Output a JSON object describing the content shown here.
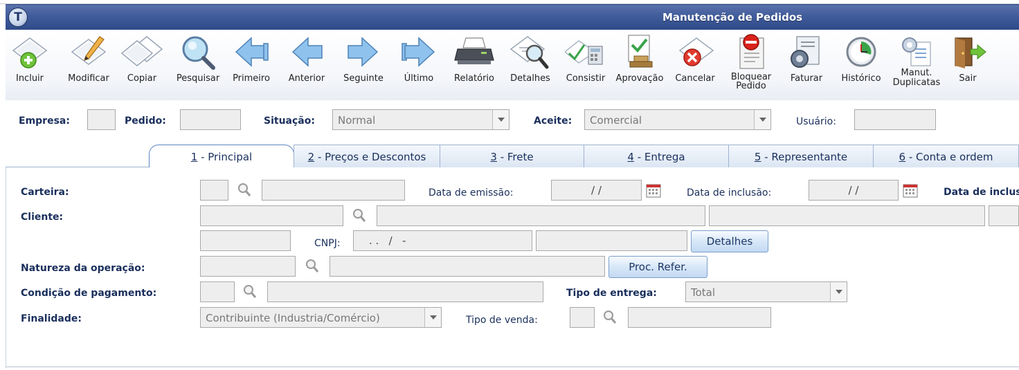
{
  "window": {
    "title": "Manutenção de Pedidos"
  },
  "toolbar": {
    "items": [
      {
        "label": "Incluir",
        "icon": "add-doc-icon"
      },
      {
        "label": "Modificar",
        "icon": "edit-doc-icon"
      },
      {
        "label": "Copiar",
        "icon": "copy-doc-icon"
      },
      {
        "label": "Pesquisar",
        "icon": "magnifier-icon"
      },
      {
        "label": "Primeiro",
        "icon": "first-arrow-icon"
      },
      {
        "label": "Anterior",
        "icon": "previous-arrow-icon"
      },
      {
        "label": "Seguinte",
        "icon": "next-arrow-icon"
      },
      {
        "label": "Último",
        "icon": "last-arrow-icon"
      },
      {
        "label": "Relatório",
        "icon": "printer-icon"
      },
      {
        "label": "Detalhes",
        "icon": "details-icon"
      },
      {
        "label": "Consistir",
        "icon": "check-calc-icon"
      },
      {
        "label": "Aprovação",
        "icon": "approval-icon"
      },
      {
        "label": "Cancelar",
        "icon": "cancel-icon"
      },
      {
        "label": "Bloquear\nPedido",
        "label_line1": "Bloquear",
        "label_line2": "Pedido",
        "icon": "block-order-icon"
      },
      {
        "label": "Faturar",
        "icon": "invoice-gear-icon"
      },
      {
        "label": "Histórico",
        "icon": "history-clock-icon"
      },
      {
        "label": "Manut.\nDuplicatas",
        "label_line1": "Manut.",
        "label_line2": "Duplicatas",
        "icon": "duplicates-gear-icon"
      },
      {
        "label": "Sair",
        "icon": "exit-door-icon"
      }
    ]
  },
  "header_fields": {
    "empresa_label": "Empresa:",
    "empresa_value": "",
    "pedido_label": "Pedido:",
    "pedido_value": "",
    "situacao_label": "Situação:",
    "situacao_value": "Normal",
    "aceite_label": "Aceite:",
    "aceite_value": "Comercial",
    "usuario_label": "Usuário:",
    "usuario_value": ""
  },
  "tabs": [
    {
      "key": "1",
      "rest": " - Principal"
    },
    {
      "key": "2",
      "rest": " - Preços e Descontos"
    },
    {
      "key": "3",
      "rest": " - Frete"
    },
    {
      "key": "4",
      "rest": " - Entrega"
    },
    {
      "key": "5",
      "rest": " - Representante"
    },
    {
      "key": "6",
      "rest": " - Conta e ordem"
    }
  ],
  "form": {
    "carteira_label": "Carteira:",
    "data_emissao_label": "Data de emissão:",
    "data_emissao_value": "/ /",
    "data_inclusao_label": "Data de inclusão:",
    "data_inclusao_value": "/ /",
    "data_inclusao2_label": "Data de inclus",
    "cliente_label": "Cliente:",
    "cnpj_label": "CNPJ:",
    "cnpj_value": ". .   /   -",
    "detalhes_button": "Detalhes",
    "natureza_label": "Natureza da operação:",
    "proc_refer_button": "Proc. Refer.",
    "condicao_label": "Condição de pagamento:",
    "tipo_entrega_label": "Tipo de entrega:",
    "tipo_entrega_value": "Total",
    "finalidade_label": "Finalidade:",
    "finalidade_value": "Contribuinte (Industria/Comércio)",
    "tipo_venda_label": "Tipo de venda:"
  }
}
